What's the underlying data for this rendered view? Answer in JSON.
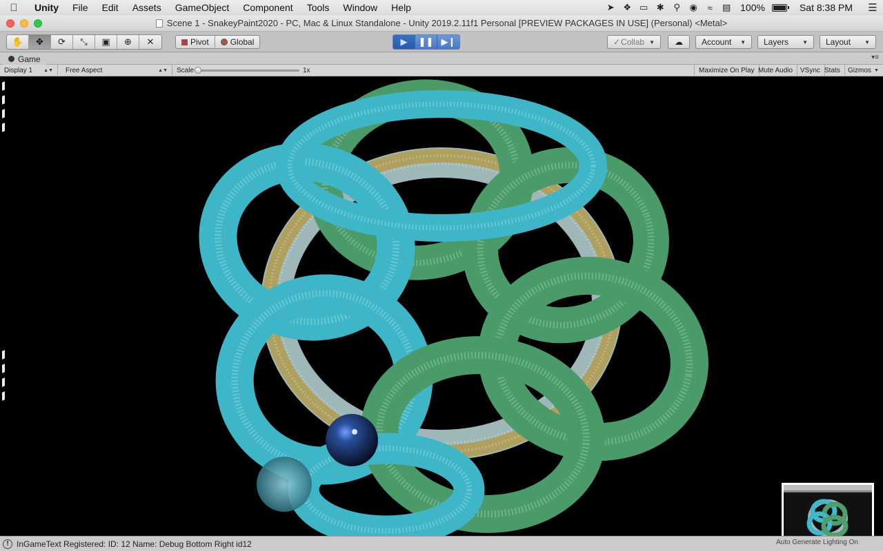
{
  "menubar": {
    "apple_icon": "apple-logo-icon",
    "items": [
      "Unity",
      "File",
      "Edit",
      "Assets",
      "GameObject",
      "Component",
      "Tools",
      "Window",
      "Help"
    ],
    "status_icons": [
      "send-icon",
      "dropbox-icon",
      "airplay-icon",
      "bluetooth-icon",
      "spotlight-search-icon",
      "siri-icon",
      "wifi-icon",
      "battery-extra-icon"
    ],
    "battery_percent": "100%",
    "battery_level": 1.0,
    "clock": "Sat 8:38 PM"
  },
  "window": {
    "title": "Scene 1 - SnakeyPaint2020 - PC, Mac & Linux Standalone - Unity 2019.2.11f1 Personal [PREVIEW PACKAGES IN USE] (Personal) <Metal>"
  },
  "toolbar": {
    "tools": [
      {
        "name": "hand-tool-icon",
        "glyph": "✋",
        "active": false
      },
      {
        "name": "move-tool-icon",
        "glyph": "✥",
        "active": true
      },
      {
        "name": "rotate-tool-icon",
        "glyph": "⟳",
        "active": false
      },
      {
        "name": "scale-tool-icon",
        "glyph": "⤡",
        "active": false
      },
      {
        "name": "rect-tool-icon",
        "glyph": "▣",
        "active": false
      },
      {
        "name": "transform-tool-icon",
        "glyph": "⊕",
        "active": false
      },
      {
        "name": "custom-tool-icon",
        "glyph": "✕",
        "active": false
      }
    ],
    "pivot_label": "Pivot",
    "global_label": "Global",
    "collab_label": "Collab",
    "account_label": "Account",
    "layers_label": "Layers",
    "layout_label": "Layout"
  },
  "game_tab": {
    "label": "Game"
  },
  "game_bar": {
    "display": "Display 1",
    "aspect": "Free Aspect",
    "scale_label": "Scale",
    "scale_value": "1x",
    "maximize": "Maximize On Play",
    "mute": "Mute Audio",
    "vsync": "VSync",
    "stats": "Stats",
    "gizmos": "Gizmos"
  },
  "status_bar": {
    "message": "InGameText Registered: ID: 12 Name: Debug Bottom Right id12",
    "right_text": "Auto Generate Lighting On"
  },
  "colors": {
    "tube_teal": "#3fb6c8",
    "tube_green": "#4a9a6a",
    "tube_gold": "#b0a060",
    "tube_pale": "#9fb7b8",
    "play_blue": "#4a78c0"
  }
}
